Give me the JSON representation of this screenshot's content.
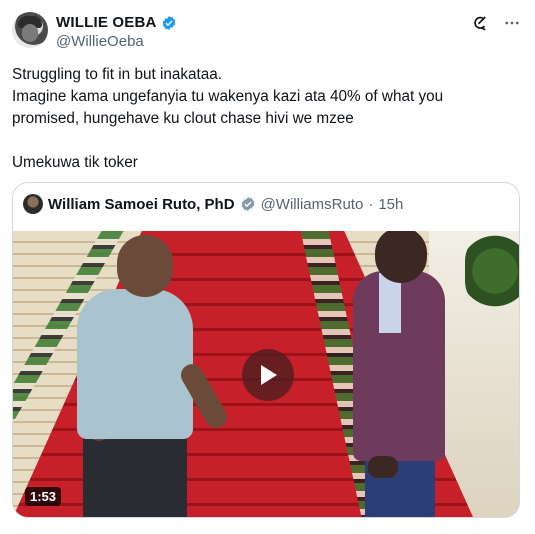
{
  "tweet": {
    "display_name": "WILLIE OEBA",
    "handle": "@WillieOeba",
    "lines": [
      "Struggling to fit in but inakataa.",
      "Imagine kama ungefanyia tu wakenya kazi ata 40% of what you promised, hungehave ku clout chase hivi we mzee",
      "Umekuwa tik toker"
    ]
  },
  "icons": {
    "verified": "verified-badge-icon",
    "grok": "grok-icon",
    "more": "more-options-icon",
    "play": "play-icon"
  },
  "quoted_tweet": {
    "display_name": "William Samoei Ruto, PhD",
    "handle": "@WilliamsRuto",
    "separator": "·",
    "time": "15h",
    "video_duration": "1:53"
  },
  "colors": {
    "verified_blue": "#1d9bf0",
    "verified_gray": "#829aab",
    "secondary_text": "#536471",
    "border": "#cfd9de"
  }
}
